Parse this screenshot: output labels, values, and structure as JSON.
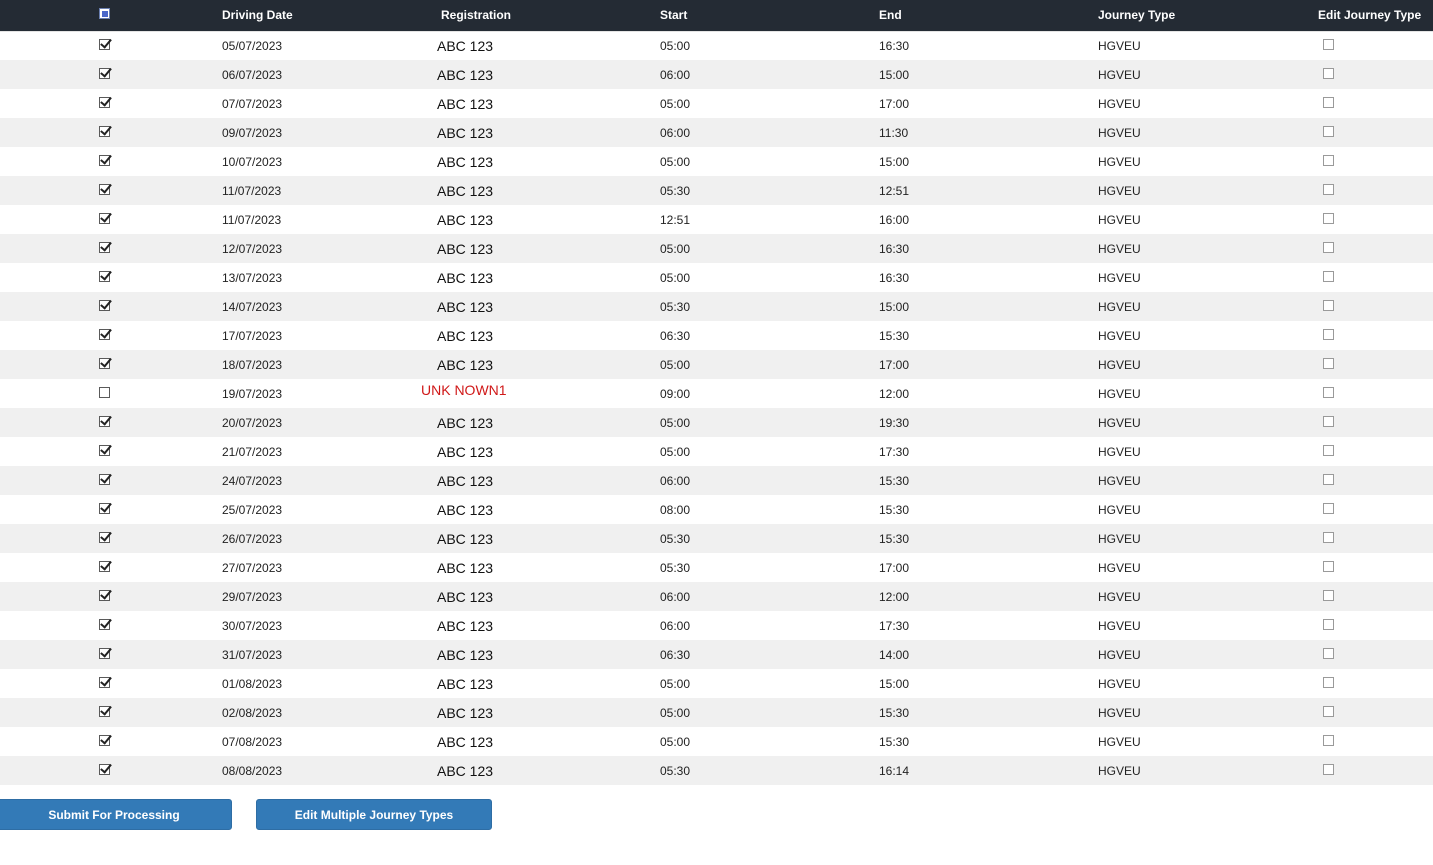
{
  "table": {
    "columns": {
      "driving_date": "Driving Date",
      "registration": "Registration",
      "start": "Start",
      "end": "End",
      "journey_type": "Journey Type",
      "edit_journey_type": "Edit Journey Type"
    },
    "select_all_state": "indeterminate",
    "rows": [
      {
        "selected": true,
        "date": "05/07/2023",
        "reg": "ABC 123",
        "start": "05:00",
        "end": "16:30",
        "type": "HGVEU",
        "edit": false
      },
      {
        "selected": true,
        "date": "06/07/2023",
        "reg": "ABC 123",
        "start": "06:00",
        "end": "15:00",
        "type": "HGVEU",
        "edit": false
      },
      {
        "selected": true,
        "date": "07/07/2023",
        "reg": "ABC 123",
        "start": "05:00",
        "end": "17:00",
        "type": "HGVEU",
        "edit": false
      },
      {
        "selected": true,
        "date": "09/07/2023",
        "reg": "ABC 123",
        "start": "06:00",
        "end": "11:30",
        "type": "HGVEU",
        "edit": false
      },
      {
        "selected": true,
        "date": "10/07/2023",
        "reg": "ABC 123",
        "start": "05:00",
        "end": "15:00",
        "type": "HGVEU",
        "edit": false
      },
      {
        "selected": true,
        "date": "11/07/2023",
        "reg": "ABC 123",
        "start": "05:30",
        "end": "12:51",
        "type": "HGVEU",
        "edit": false
      },
      {
        "selected": true,
        "date": "11/07/2023",
        "reg": "ABC 123",
        "start": "12:51",
        "end": "16:00",
        "type": "HGVEU",
        "edit": false
      },
      {
        "selected": true,
        "date": "12/07/2023",
        "reg": "ABC 123",
        "start": "05:00",
        "end": "16:30",
        "type": "HGVEU",
        "edit": false
      },
      {
        "selected": true,
        "date": "13/07/2023",
        "reg": "ABC 123",
        "start": "05:00",
        "end": "16:30",
        "type": "HGVEU",
        "edit": false
      },
      {
        "selected": true,
        "date": "14/07/2023",
        "reg": "ABC 123",
        "start": "05:30",
        "end": "15:00",
        "type": "HGVEU",
        "edit": false
      },
      {
        "selected": true,
        "date": "17/07/2023",
        "reg": "ABC 123",
        "start": "06:30",
        "end": "15:30",
        "type": "HGVEU",
        "edit": false
      },
      {
        "selected": true,
        "date": "18/07/2023",
        "reg": "ABC 123",
        "start": "05:00",
        "end": "17:00",
        "type": "HGVEU",
        "edit": false
      },
      {
        "selected": false,
        "date": "19/07/2023",
        "reg": "UNK NOWN1",
        "start": "09:00",
        "end": "12:00",
        "type": "HGVEU",
        "edit": false,
        "reg_unknown": true
      },
      {
        "selected": true,
        "date": "20/07/2023",
        "reg": "ABC 123",
        "start": "05:00",
        "end": "19:30",
        "type": "HGVEU",
        "edit": false
      },
      {
        "selected": true,
        "date": "21/07/2023",
        "reg": "ABC 123",
        "start": "05:00",
        "end": "17:30",
        "type": "HGVEU",
        "edit": false
      },
      {
        "selected": true,
        "date": "24/07/2023",
        "reg": "ABC 123",
        "start": "06:00",
        "end": "15:30",
        "type": "HGVEU",
        "edit": false
      },
      {
        "selected": true,
        "date": "25/07/2023",
        "reg": "ABC 123",
        "start": "08:00",
        "end": "15:30",
        "type": "HGVEU",
        "edit": false
      },
      {
        "selected": true,
        "date": "26/07/2023",
        "reg": "ABC 123",
        "start": "05:30",
        "end": "15:30",
        "type": "HGVEU",
        "edit": false
      },
      {
        "selected": true,
        "date": "27/07/2023",
        "reg": "ABC 123",
        "start": "05:30",
        "end": "17:00",
        "type": "HGVEU",
        "edit": false
      },
      {
        "selected": true,
        "date": "29/07/2023",
        "reg": "ABC 123",
        "start": "06:00",
        "end": "12:00",
        "type": "HGVEU",
        "edit": false
      },
      {
        "selected": true,
        "date": "30/07/2023",
        "reg": "ABC 123",
        "start": "06:00",
        "end": "17:30",
        "type": "HGVEU",
        "edit": false
      },
      {
        "selected": true,
        "date": "31/07/2023",
        "reg": "ABC 123",
        "start": "06:30",
        "end": "14:00",
        "type": "HGVEU",
        "edit": false
      },
      {
        "selected": true,
        "date": "01/08/2023",
        "reg": "ABC 123",
        "start": "05:00",
        "end": "15:00",
        "type": "HGVEU",
        "edit": false
      },
      {
        "selected": true,
        "date": "02/08/2023",
        "reg": "ABC 123",
        "start": "05:00",
        "end": "15:30",
        "type": "HGVEU",
        "edit": false
      },
      {
        "selected": true,
        "date": "07/08/2023",
        "reg": "ABC 123",
        "start": "05:00",
        "end": "15:30",
        "type": "HGVEU",
        "edit": false
      },
      {
        "selected": true,
        "date": "08/08/2023",
        "reg": "ABC 123",
        "start": "05:30",
        "end": "16:14",
        "type": "HGVEU",
        "edit": false
      }
    ]
  },
  "actions": {
    "submit_label": "Submit For Processing",
    "edit_multiple_label": "Edit Multiple Journey Types"
  },
  "colors": {
    "header_bg": "#242b34",
    "button_bg": "#337ab7",
    "unknown_reg": "#d01818"
  }
}
